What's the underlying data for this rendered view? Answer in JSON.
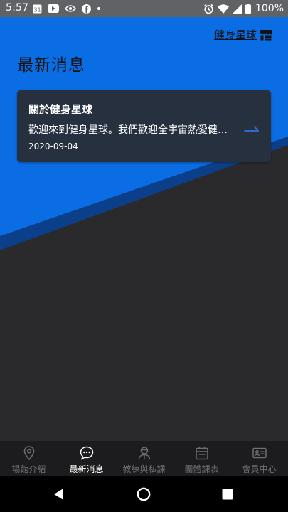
{
  "status_bar": {
    "time": "5:57",
    "battery_percent": "100%",
    "left_icons": [
      "calendar-icon",
      "youtube-icon",
      "eye-icon",
      "facebook-icon",
      "dot-icon"
    ],
    "right_icons": [
      "alarm-icon",
      "wifi-icon",
      "signal-icon",
      "battery-icon"
    ]
  },
  "header": {
    "link_label": "健身星球",
    "link_icon": "storefront-icon"
  },
  "page": {
    "title": "最新消息"
  },
  "news": [
    {
      "title": "關於健身星球",
      "excerpt": "歡迎來到健身星球。我們歡迎全宇宙熱愛健身...",
      "date": "2020-09-04"
    }
  ],
  "bottom_nav": {
    "items": [
      {
        "label": "場館介紹",
        "icon": "location-pin-icon",
        "active": false
      },
      {
        "label": "最新消息",
        "icon": "chat-bubble-icon",
        "active": true
      },
      {
        "label": "教練與私課",
        "icon": "coach-icon",
        "active": false
      },
      {
        "label": "團體課表",
        "icon": "calendar-icon",
        "active": false
      },
      {
        "label": "會員中心",
        "icon": "member-card-icon",
        "active": false
      }
    ]
  },
  "colors": {
    "primary_blue": "#0a6de3",
    "dark_blue": "#0b3f8a",
    "background_dark": "#2a2a2c",
    "card": "#26303f",
    "nav_bg": "#1c1c1e",
    "accent_arrow": "#2b7ff0"
  }
}
